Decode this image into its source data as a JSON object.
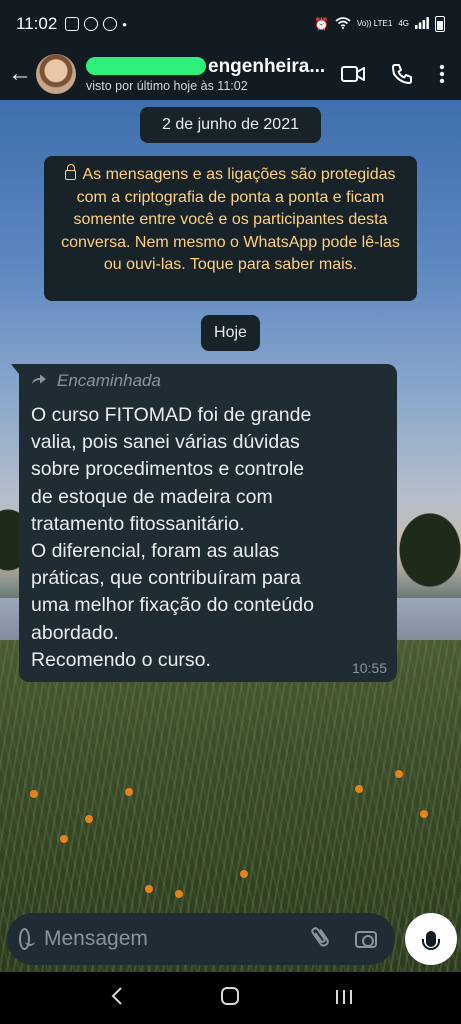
{
  "status_bar": {
    "time": "11:02",
    "network_label": "Vo)) LTE1",
    "network_type": "4G"
  },
  "header": {
    "contact_name": "engenheira...",
    "last_seen": "visto por último hoje às 11:02"
  },
  "chat": {
    "date_chip": "2 de junho de 2021",
    "encryption_notice": "As mensagens e as ligações são protegidas com a criptografia de ponta a ponta e ficam somente entre você e os participantes desta conversa. Nem mesmo o WhatsApp pode lê-las ou ouvi-las. Toque para saber mais.",
    "today_chip": "Hoje",
    "message": {
      "forwarded_label": "Encaminhada",
      "text": "O curso FITOMAD foi de grande\nvalia, pois sanei várias dúvidas\nsobre procedimentos e controle\nde estoque de madeira com\ntratamento fitossanitário.\nO diferencial, foram as aulas\npráticas, que contribuíram para\numa melhor fixação do conteúdo\nabordado.\nRecomendo o curso.",
      "time": "10:55"
    }
  },
  "input": {
    "placeholder": "Mensagem"
  },
  "colors": {
    "header_bg": "#111b21",
    "bubble_bg": "#202c33",
    "notice_text": "#ffd279",
    "meta_text": "#8696a0"
  },
  "icons": [
    "back-arrow-icon",
    "video-call-icon",
    "phone-icon",
    "more-options-icon",
    "lock-icon",
    "forward-icon",
    "emoji-icon",
    "attach-icon",
    "camera-icon",
    "mic-icon"
  ]
}
